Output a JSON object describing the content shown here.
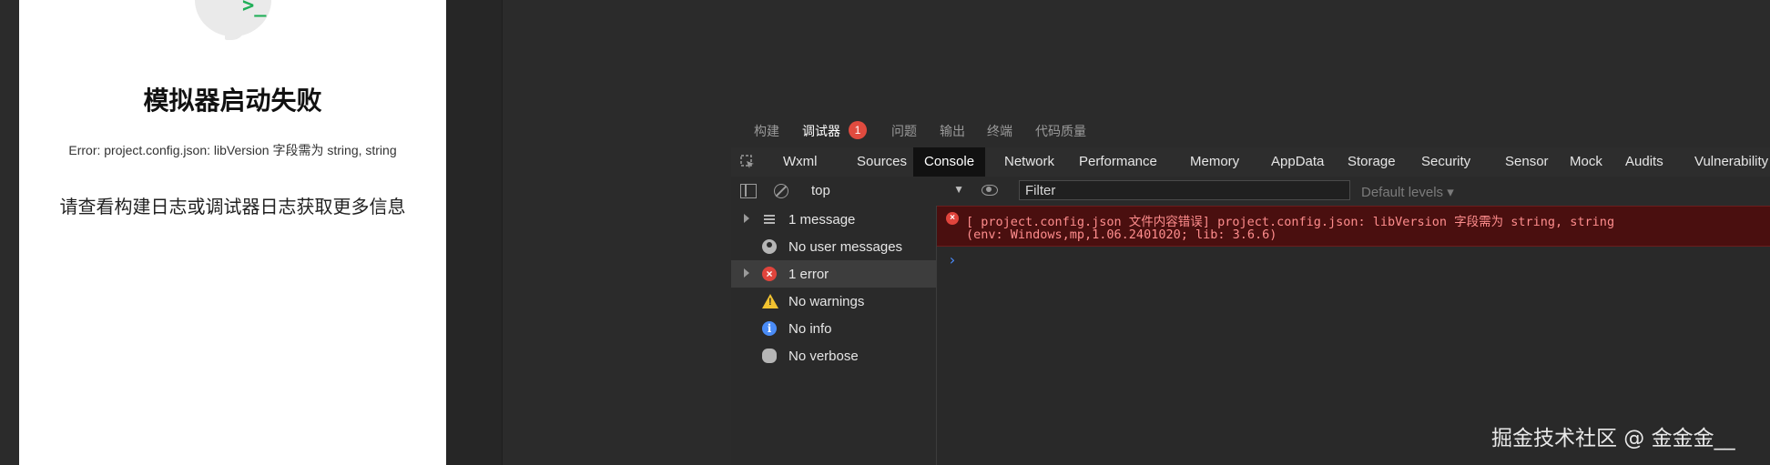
{
  "simulator": {
    "title": "模拟器启动失败",
    "error_text": "Error: project.config.json: libVersion 字段需为 string, string",
    "hint_text": "请查看构建日志或调试器日志获取更多信息"
  },
  "devtools": {
    "top_tabs": [
      {
        "label": "构建"
      },
      {
        "label": "调试器",
        "badge": "1"
      },
      {
        "label": "问题"
      },
      {
        "label": "输出"
      },
      {
        "label": "终端"
      },
      {
        "label": "代码质量"
      }
    ],
    "panel_tabs": [
      "Wxml",
      "Sources",
      "Console",
      "Network",
      "Performance",
      "Memory",
      "AppData",
      "Storage",
      "Security",
      "Sensor",
      "Mock",
      "Audits",
      "Vulnerability"
    ],
    "active_panel": "Console",
    "console_toolbar": {
      "context": "top",
      "filter_placeholder": "Filter",
      "levels": "Default levels"
    },
    "sidebar": [
      {
        "label": "1 message",
        "icon": "list-icon"
      },
      {
        "label": "No user messages",
        "icon": "user-icon"
      },
      {
        "label": "1 error",
        "icon": "error-icon"
      },
      {
        "label": "No warnings",
        "icon": "warning-icon"
      },
      {
        "label": "No info",
        "icon": "info-icon"
      },
      {
        "label": "No verbose",
        "icon": "bug-icon"
      }
    ],
    "console_error": {
      "line1": "[ project.config.json 文件内容错误] project.config.json: libVersion 字段需为 string, string",
      "line2": "(env: Windows,mp,1.06.2401020; lib: 3.6.6)"
    },
    "prompt": "›"
  },
  "watermark": "掘金技术社区 @ 金金金__",
  "colors": {
    "error_bg": "#4a0f0f",
    "error_text": "#ff8d8d",
    "badge": "#e04b3f",
    "success_green": "#1fae57"
  }
}
